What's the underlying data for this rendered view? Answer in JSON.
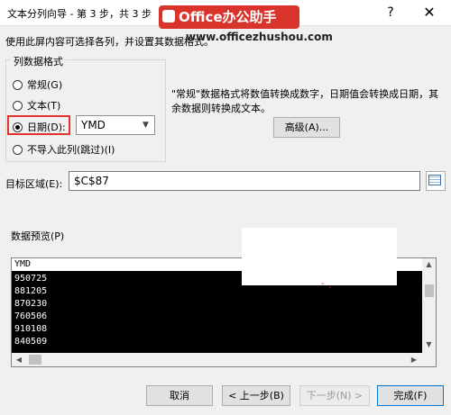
{
  "window": {
    "title": "文本分列向导 - 第 3 步，共 3 步",
    "help": "?",
    "close": "✕"
  },
  "watermark": {
    "badge": "Office办公助手",
    "url": "www.officezhushou.com"
  },
  "intro": "使用此屏内容可选择各列，并设置其数据格式。",
  "column_format": {
    "legend": "列数据格式",
    "options": [
      {
        "label": "常规(G)",
        "checked": false
      },
      {
        "label": "文本(T)",
        "checked": false
      },
      {
        "label": "日期(D):",
        "checked": true
      },
      {
        "label": "不导入此列(跳过)(I)",
        "checked": false
      }
    ],
    "date_order": "YMD"
  },
  "description": {
    "line1": "\"常规\"数据格式将数值转换成数字，日期值会转换成日期，其",
    "line2": "余数据则转换成文本。"
  },
  "advanced_button": "高级(A)...",
  "destination": {
    "label": "目标区域(E):",
    "value": "$C$87"
  },
  "preview": {
    "label": "数据预览(P)",
    "header": "YMD",
    "rows": [
      "950725",
      "881205",
      "870230",
      "760506",
      "910108",
      "840509"
    ]
  },
  "buttons": {
    "cancel": "取消",
    "back": "< 上一步(B)",
    "next": "下一步(N) >",
    "finish": "完成(F)"
  }
}
